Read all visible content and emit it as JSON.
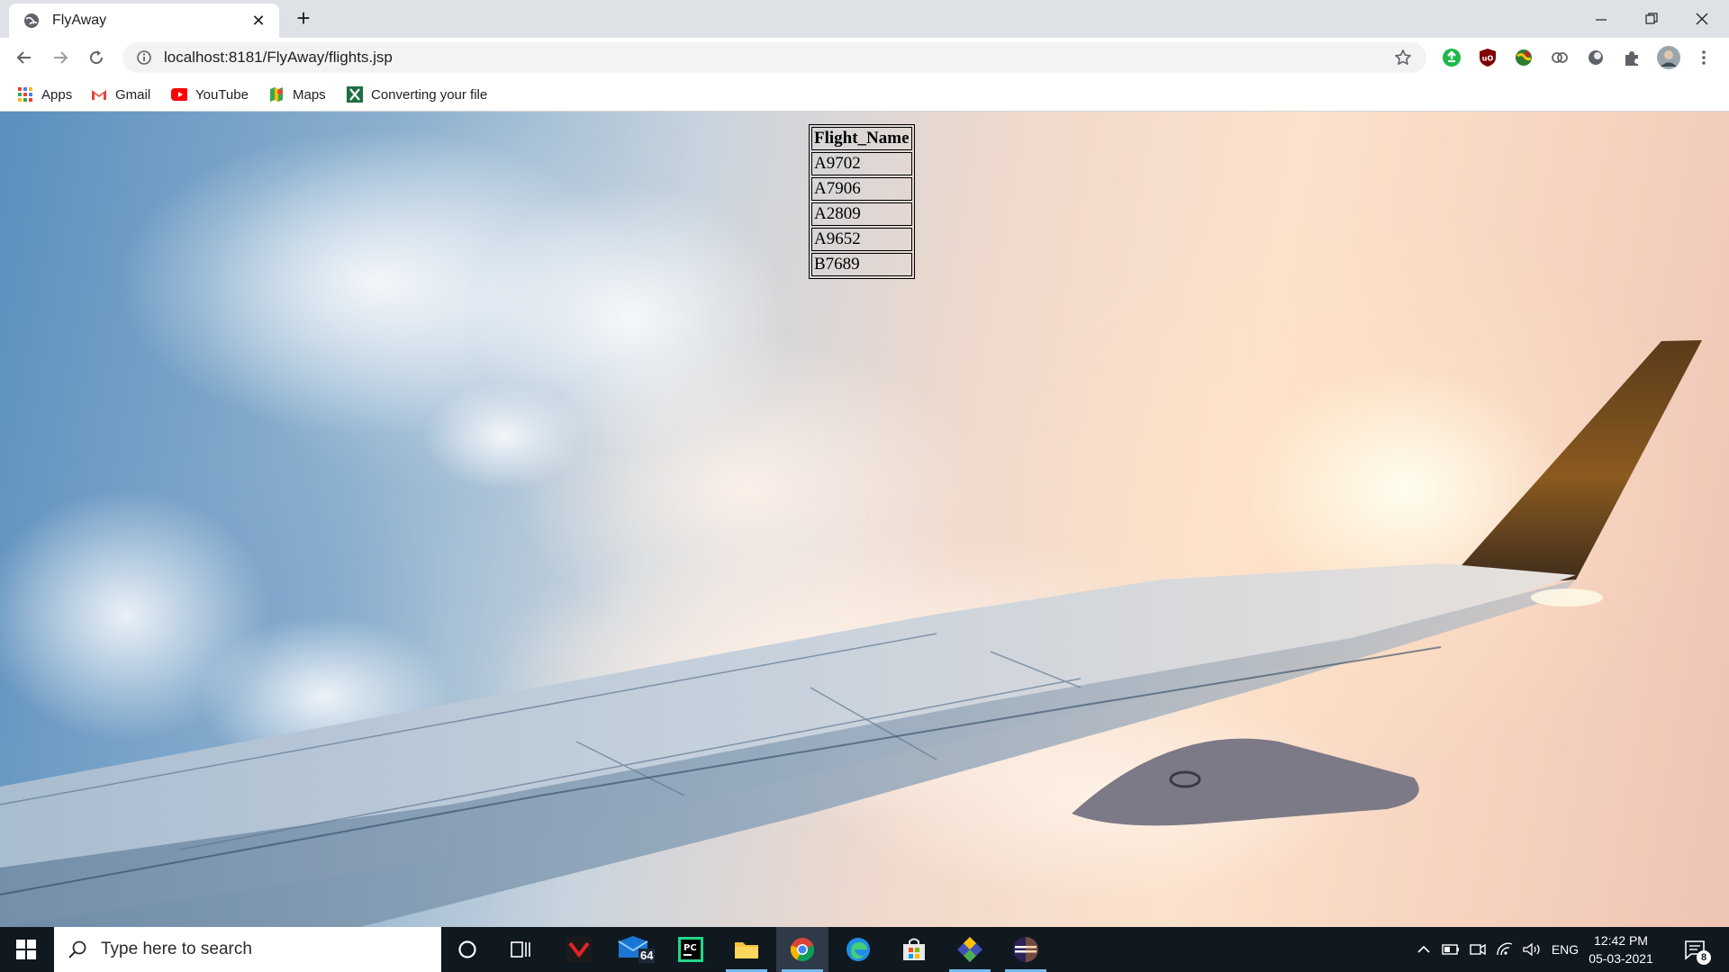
{
  "browser": {
    "tab_title": "FlyAway",
    "url": "localhost:8181/FlyAway/flights.jsp"
  },
  "bookmarks": [
    {
      "label": "Apps",
      "icon": "apps-grid-icon"
    },
    {
      "label": "Gmail",
      "icon": "gmail-icon"
    },
    {
      "label": "YouTube",
      "icon": "youtube-icon"
    },
    {
      "label": "Maps",
      "icon": "maps-icon"
    },
    {
      "label": "Converting your file",
      "icon": "converter-icon"
    }
  ],
  "flights_table": {
    "header": "Flight_Name",
    "rows": [
      "A9702",
      "A7906",
      "A2809",
      "A9652",
      "B7689"
    ]
  },
  "taskbar": {
    "search_placeholder": "Type here to search",
    "mail_badge": "64",
    "language": "ENG",
    "time": "12:42 PM",
    "date": "05-03-2021",
    "notification_count": "8"
  },
  "colors": {
    "taskbar": "#101820",
    "tabstrip": "#dee1e6",
    "omnibox": "#f1f3f4"
  }
}
